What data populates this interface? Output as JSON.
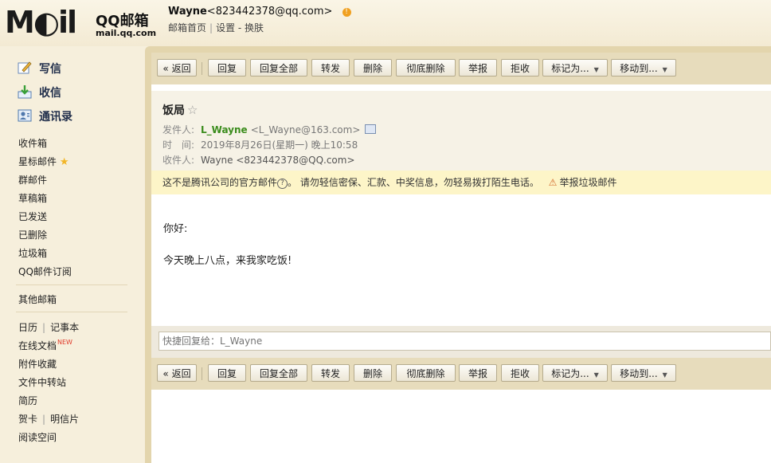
{
  "header": {
    "logo_mark": "M◐il",
    "logo_brand": "QQ邮箱",
    "logo_domain": "mail.qq.com",
    "user_name": "Wayne",
    "user_email": "<823442378@qq.com>",
    "links": [
      "邮箱首页",
      "设置",
      "换肤"
    ]
  },
  "sidebar": {
    "compose": "写信",
    "inbox_check": "收信",
    "contacts": "通讯录",
    "folders": [
      "收件箱",
      "星标邮件",
      "群邮件",
      "草稿箱",
      "已发送",
      "已删除",
      "垃圾箱",
      "QQ邮件订阅"
    ],
    "other_mailbox": "其他邮箱",
    "apps": {
      "calendar": "日历",
      "notebook": "记事本",
      "online_docs": "在线文档",
      "new_tag": "NEW",
      "attachments": "附件收藏",
      "file_transfer": "文件中转站",
      "resume": "简历",
      "card": "贺卡",
      "postcard": "明信片",
      "reading": "阅读空间"
    }
  },
  "toolbar": {
    "back": "« 返回",
    "reply": "回复",
    "reply_all": "回复全部",
    "forward": "转发",
    "delete": "删除",
    "delete_forever": "彻底删除",
    "report": "举报",
    "reject": "拒收",
    "mark_as": "标记为...",
    "move_to": "移动到..."
  },
  "mail": {
    "subject": "饭局",
    "from_label": "发件人:",
    "from_name": "L_Wayne",
    "from_addr": "<L_Wayne@163.com>",
    "time_label": "时　间:",
    "time_value": "2019年8月26日(星期一) 晚上10:58",
    "to_label": "收件人:",
    "to_value": "Wayne <823442378@QQ.com>",
    "notice_text": "这不是腾讯公司的官方邮件",
    "notice_warning": "。 请勿轻信密保、汇款、中奖信息，勿轻易拨打陌生电话。",
    "notice_report": "举报垃圾邮件",
    "body_lines": [
      "你好:",
      "今天晚上八点，来我家吃饭!"
    ]
  },
  "quick_reply": {
    "placeholder": "快捷回复给：L_Wayne"
  }
}
